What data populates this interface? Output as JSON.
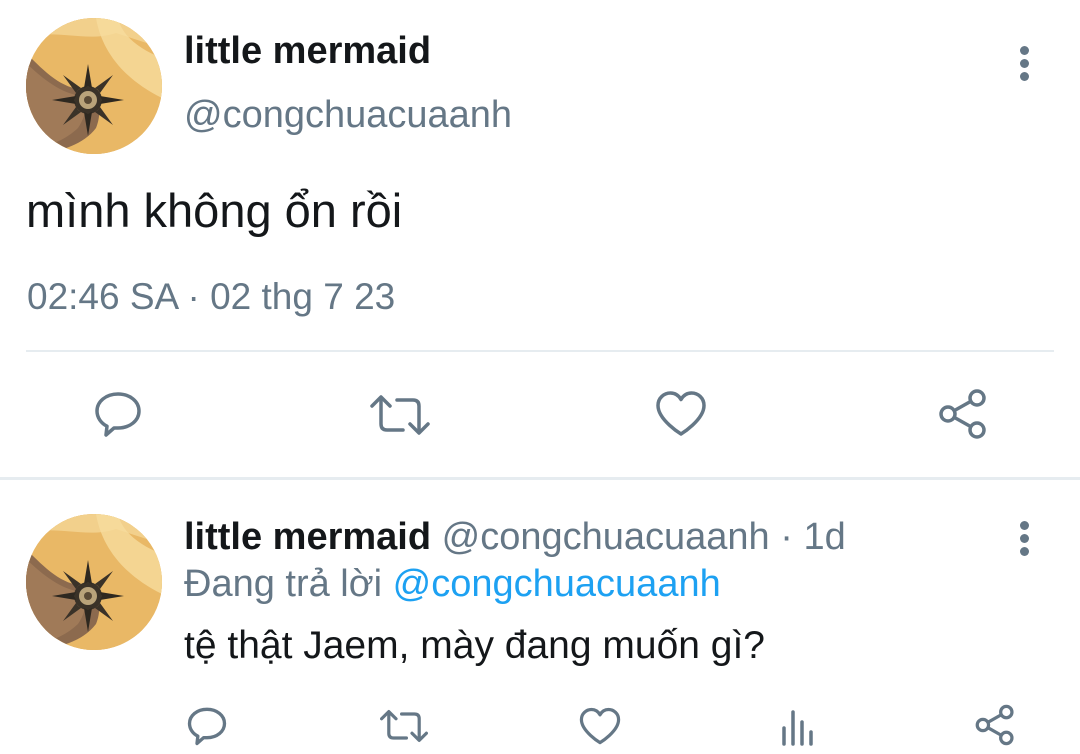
{
  "tweet": {
    "display_name": "little mermaid",
    "handle": "@congchuacuaanh",
    "text": "mình không ổn rồi",
    "time": "02:46 SA",
    "separator": " · ",
    "date": "02 thg 7 23",
    "icons": {
      "more": "more-vertical-icon",
      "reply": "reply-bubble-icon",
      "retweet": "retweet-icon",
      "like": "heart-icon",
      "share": "share-icon"
    }
  },
  "reply": {
    "display_name": "little mermaid",
    "handle": "@congchuacuaanh",
    "age": " · 1d",
    "replying_prefix": "Đang trả lời ",
    "replying_to": "@congchuacuaanh",
    "text": "tệ thật Jaem, mày đang muốn gì?",
    "icons": {
      "more": "more-vertical-icon",
      "reply": "reply-bubble-icon",
      "retweet": "retweet-icon",
      "like": "heart-icon",
      "analytics": "analytics-bars-icon",
      "share": "share-icon"
    }
  },
  "colors": {
    "text_primary": "#14171a",
    "text_secondary": "#657786",
    "accent": "#1da1f2",
    "divider": "#e6ecf0"
  }
}
